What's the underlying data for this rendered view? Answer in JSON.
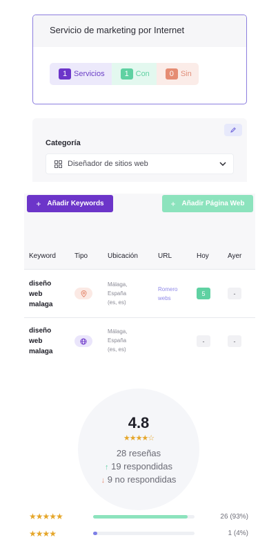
{
  "service": {
    "title": "Servicio de marketing por Internet",
    "counts": [
      {
        "num": "1",
        "label": "Servicios"
      },
      {
        "num": "1",
        "label": "Con"
      },
      {
        "num": "0",
        "label": "Sin"
      }
    ]
  },
  "category": {
    "label": "Categoría",
    "selected": "Diseñador de sitios web"
  },
  "keywords": {
    "add_keywords": "Añadir Keywords",
    "add_web": "Añadir Página Web",
    "plus": "+",
    "columns": [
      "Keyword",
      "Tipo",
      "Ubicación",
      "URL",
      "Hoy",
      "Ayer"
    ],
    "rows": [
      {
        "keyword": [
          "diseño",
          "web",
          "malaga"
        ],
        "type_icon": "map-pin-icon",
        "location": [
          "Málaga,",
          "España",
          "(es, es)"
        ],
        "url": [
          "Romero",
          "webs"
        ],
        "today": "5",
        "yesterday": "-"
      },
      {
        "keyword": [
          "diseño",
          "web",
          "malaga"
        ],
        "type_icon": "globe-icon",
        "location": [
          "Málaga,",
          "España",
          "(es, es)"
        ],
        "url": [],
        "today": "-",
        "yesterday": "-"
      }
    ]
  },
  "reviews": {
    "score": "4.8",
    "stars": "★★★★☆",
    "total": "28 reseñas",
    "responded": "19 respondidas",
    "unresponded": "9 no respondidas",
    "up_arrow": "↑",
    "down_arrow": "↓",
    "distribution": [
      {
        "stars": "★★★★★",
        "fraction": 0.93,
        "label": "26 (93%)"
      },
      {
        "stars": "★★★★",
        "fraction": 0.04,
        "label": "1 (4%)"
      }
    ]
  },
  "colors": {
    "primary": "#6c35c9",
    "green": "#5fd1a2",
    "orange": "#e58c73",
    "star": "#e5a62a"
  }
}
